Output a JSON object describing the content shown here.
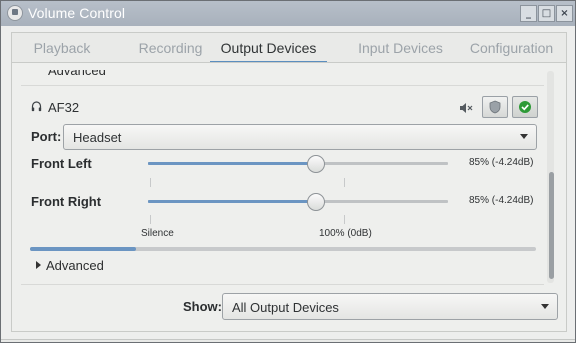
{
  "window": {
    "title": "Volume Control",
    "controls": [
      "_",
      "□",
      "×"
    ]
  },
  "tabs": [
    {
      "label": "Playback",
      "active": false
    },
    {
      "label": "Recording",
      "active": false
    },
    {
      "label": "Output Devices",
      "active": true
    },
    {
      "label": "Input Devices",
      "active": false
    },
    {
      "label": "Configuration",
      "active": false
    }
  ],
  "device": {
    "partial_label": "Advanced",
    "name": "AF32",
    "icons": [
      "headphones-icon",
      "mute-speaker-icon",
      "shield-icon",
      "check-icon"
    ],
    "port_label": "Port:",
    "port_value": "Headset",
    "channels": [
      {
        "label": "Front Left",
        "level_percent": 85,
        "value_text": "85% (-4.24dB)"
      },
      {
        "label": "Front Right",
        "level_percent": 85,
        "value_text": "85% (-4.24dB)"
      }
    ],
    "scale": {
      "silence": "Silence",
      "full": "100% (0dB)"
    },
    "peak_fraction": 0.21,
    "advanced_label": "Advanced"
  },
  "filter": {
    "label": "Show:",
    "value": "All Output Devices"
  },
  "colors": {
    "accent": "#6b95c2",
    "titlebar": "#aeb6c0",
    "verify_green": "#2e9a37"
  }
}
